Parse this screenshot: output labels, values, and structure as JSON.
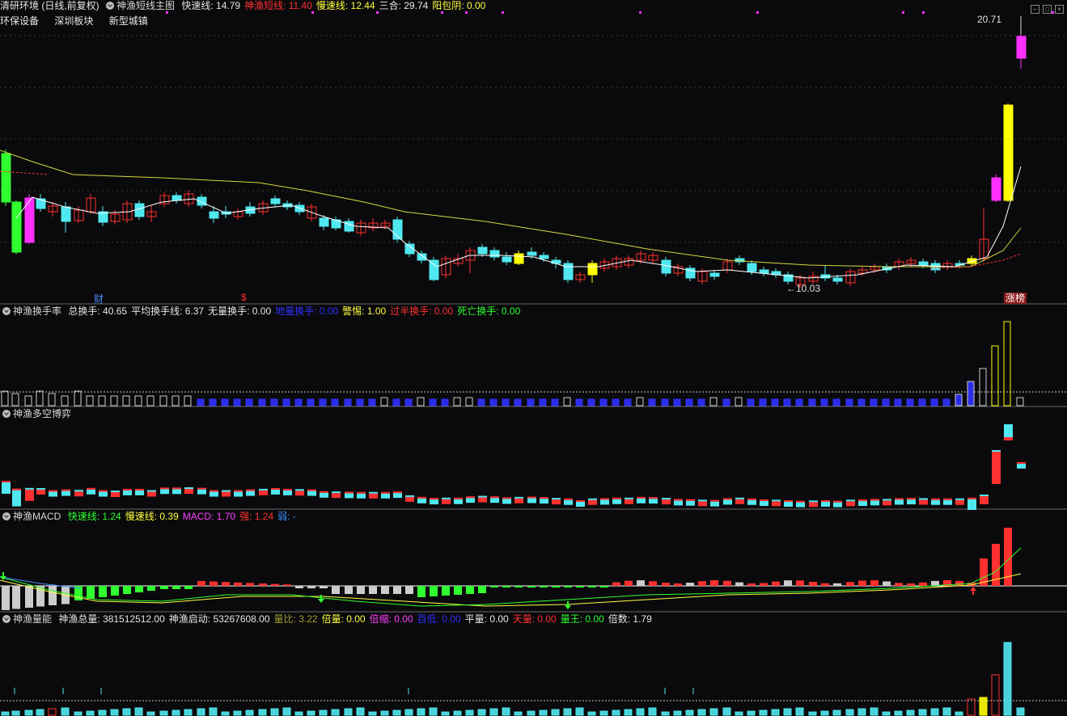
{
  "main_header": {
    "stock_name": "清研环境 (日线,前复权)",
    "indicator_name": "神渔短线主图",
    "items": [
      {
        "label": "快速线: 14.79",
        "color": "#e6e6e6"
      },
      {
        "label": "神渔短线: 11.40",
        "color": "#ff3030"
      },
      {
        "label": "慢速线: 12.44",
        "color": "#ffff40"
      },
      {
        "label": "三合: 29.74",
        "color": "#e6e6e6"
      },
      {
        "label": "阳包阴: 0.00",
        "color": "#ffff40"
      }
    ]
  },
  "boards": [
    "环保设备",
    "深圳板块",
    "新型城镇"
  ],
  "main_chart": {
    "max_label": "20.71",
    "min_label": "10.03",
    "marker_cai": "财",
    "marker_s": "$",
    "limit_up": "涨榜"
  },
  "turnover_panel": {
    "name": "神渔换手率",
    "items": [
      {
        "label": "总换手: 40.65",
        "color": "#e6e6e6"
      },
      {
        "label": "平均换手线: 6.37",
        "color": "#e6e6e6"
      },
      {
        "label": "无量换手: 0.00",
        "color": "#e6e6e6"
      },
      {
        "label": "地量换手: 0.00",
        "color": "#3030ff"
      },
      {
        "label": "警惕: 1.00",
        "color": "#ffff40"
      },
      {
        "label": "过半换手: 0.00",
        "color": "#ff3030"
      },
      {
        "label": "死亡换手: 0.00",
        "color": "#30ff30"
      }
    ]
  },
  "game_panel": {
    "name": "神渔多空博弈"
  },
  "macd_panel": {
    "name": "神渔MACD",
    "items": [
      {
        "label": "快速线: 1.24",
        "color": "#30ff30"
      },
      {
        "label": "慢速线: 0.39",
        "color": "#ffff40"
      },
      {
        "label": "MACD: 1.70",
        "color": "#ff40ff"
      },
      {
        "label": "强: 1.24",
        "color": "#ff3030"
      },
      {
        "label": "弱: -",
        "color": "#4090ff"
      }
    ]
  },
  "volume_panel": {
    "name": "神渔量能",
    "items": [
      {
        "label": "神渔总量: 381512512.00",
        "color": "#e6e6e6"
      },
      {
        "label": "神渔启动: 53267608.00",
        "color": "#e6e6e6"
      },
      {
        "label": "量比: 3.22",
        "color": "#a0a030"
      },
      {
        "label": "倍量: 0.00",
        "color": "#ffff40"
      },
      {
        "label": "倍缩: 0.00",
        "color": "#ff40ff"
      },
      {
        "label": "百低: 0.00",
        "color": "#3030ff"
      },
      {
        "label": "平量: 0.00",
        "color": "#e6e6e6"
      },
      {
        "label": "天量: 0.00",
        "color": "#ff3030"
      },
      {
        "label": "量王: 0.00",
        "color": "#30ff30"
      },
      {
        "label": "倍数: 1.79",
        "color": "#e6e6e6"
      }
    ]
  },
  "colors": {
    "up": "#ff3030",
    "down": "#50e8f0",
    "bg": "#0a0a0c",
    "grid": "#3a3a3a",
    "yellow": "#ffff00",
    "magenta": "#ff30ff",
    "green": "#30ff30"
  }
}
